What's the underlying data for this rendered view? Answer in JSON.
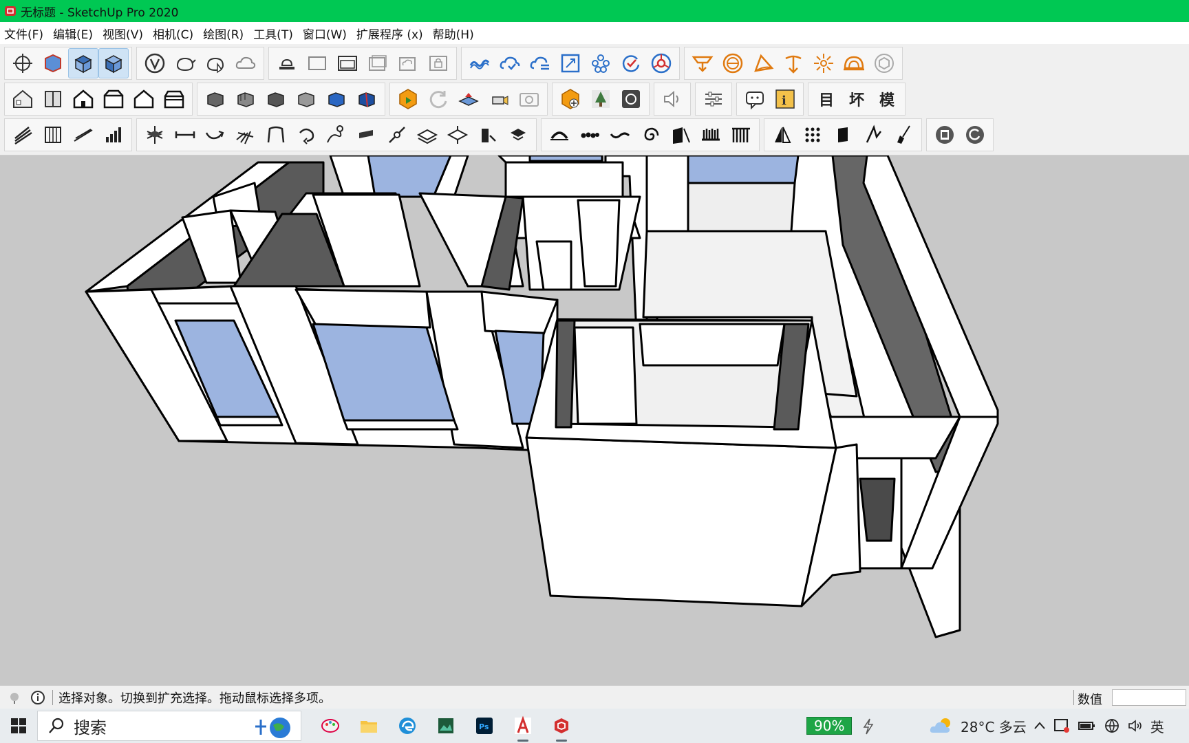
{
  "window": {
    "title": "无标题 - SketchUp Pro 2020",
    "title_bar_color": "#00c853"
  },
  "menu": {
    "items": [
      "文件(F)",
      "编辑(E)",
      "视图(V)",
      "相机(C)",
      "绘图(R)",
      "工具(T)",
      "窗口(W)",
      "扩展程序 (x)",
      "帮助(H)"
    ]
  },
  "toolbars": {
    "row3_text_buttons": [
      "目",
      "坏",
      "模"
    ],
    "active_icons": [
      "iso-view-icon",
      "top-view-icon"
    ]
  },
  "viewport": {
    "background_color": "#c8c8c8",
    "model_description_icon": "3d-floorplan-model"
  },
  "status": {
    "message": "选择对象。切换到扩充选择。拖动鼠标选择多项。",
    "measure_label": "数值"
  },
  "taskbar": {
    "search_label": "搜索",
    "zoom_badge": "90%",
    "weather": "28°C 多云",
    "ime": "英"
  }
}
